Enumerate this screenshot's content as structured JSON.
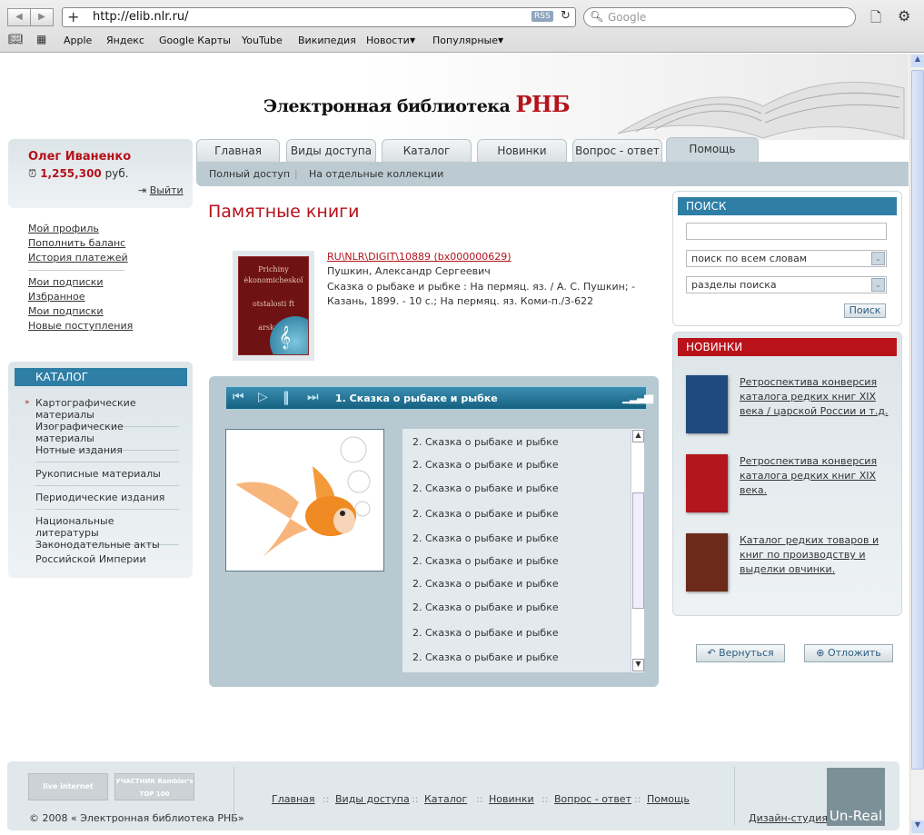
{
  "browser": {
    "url": "http://elib.nlr.ru/",
    "search_placeholder": "Google",
    "rss": "RSS",
    "bookmarks": [
      "Apple",
      "Яндекс",
      "Google Карты",
      "YouTube",
      "Википедия",
      "Новости",
      "Популярные"
    ]
  },
  "site": {
    "title_main": "Электронная библиотека ",
    "title_accent": "РНБ"
  },
  "tabs": [
    "Главная",
    "Виды доступа",
    "Каталог",
    "Новинки",
    "Вопрос - ответ",
    "Помощь"
  ],
  "active_tab": "Помощь",
  "subnav": [
    "Полный доступ",
    "На отдельные коллекции"
  ],
  "user": {
    "name": "Олег Иваненко",
    "balance": "1,255,300",
    "currency": "руб.",
    "logout": "Выйти"
  },
  "account_links": [
    "Мой профиль",
    "Пополнить баланс",
    "История платежей"
  ],
  "account_links2": [
    "Мои подписки",
    "Избранное",
    "Мои подписки",
    "Новые поступления"
  ],
  "catalog": {
    "title": "КАТАЛОГ",
    "items": [
      "Картографические  материалы",
      "Изографические материалы",
      "Нотные издания",
      "Рукописные материалы",
      "Периодические издания",
      "Национальные литературы",
      "Законодательные акты Российской Империи"
    ]
  },
  "page_title": "Памятные книги",
  "record": {
    "id": "RU\\NLR\\DIGIT\\10889 (bx000000629)",
    "author": "Пушкин, Александр Сергеевич",
    "description": "Сказка о рыбаке и рыбке : На пермяц. яз. / А. С. Пушкин; - Казань, 1899. - 10 с.; На пермяц. яз. Коми-п./3-622",
    "cover_text": [
      "Prichiny",
      "ėkonomicheskoĭ",
      "otstalosti ft",
      "arskol R"
    ]
  },
  "player": {
    "now_playing": "1. Сказка о рыбаке и рыбке",
    "playlist": [
      "2. Сказка о рыбаке и рыбке",
      "2. Сказка о рыбаке и рыбке",
      "2. Сказка о рыбаке и рыбке",
      "2. Сказка о рыбаке и рыбке",
      "2. Сказка о рыбаке и рыбке",
      "2. Сказка о рыбаке и рыбке",
      "2. Сказка о рыбаке и рыбке",
      "2. Сказка о рыбаке и рыбке",
      "2. Сказка о рыбаке и рыбке",
      "2. Сказка о рыбаке и рыбке"
    ]
  },
  "search": {
    "title": "ПОИСК",
    "mode": "поиск по всем словам",
    "sections": "разделы поиска",
    "button": "Поиск"
  },
  "news": {
    "title": "НОВИНКИ",
    "items": [
      {
        "text": "Ретроспектива конверсия каталога редких книг XIX века / царской России и т.д.",
        "color": "#1f4a80"
      },
      {
        "text": "Ретроспектива конверсия каталога редких книг XIX века.",
        "color": "#b3161d"
      },
      {
        "text": "Каталог редких товаров и книг по производству и выделки овчинки.",
        "color": "#6b2a1a"
      }
    ]
  },
  "actions": {
    "back": "Вернуться",
    "defer": "Отложить"
  },
  "footer": {
    "links": [
      "Главная",
      "Виды доступа",
      "Каталог",
      "Новинки",
      "Вопрос - ответ",
      "Помощь"
    ],
    "copyright": "© 2008 « Электронная библиотека РНБ»",
    "studio_label": "Дизайн-студия",
    "studio_logo": "Un-Real",
    "counter1": "live internet",
    "counter2": "УЧАСТНИК Rambler's TOP 100"
  },
  "colors": {
    "accent_red": "#b5121b",
    "accent_blue": "#2e7ea6",
    "panel": "#bccbd2"
  }
}
